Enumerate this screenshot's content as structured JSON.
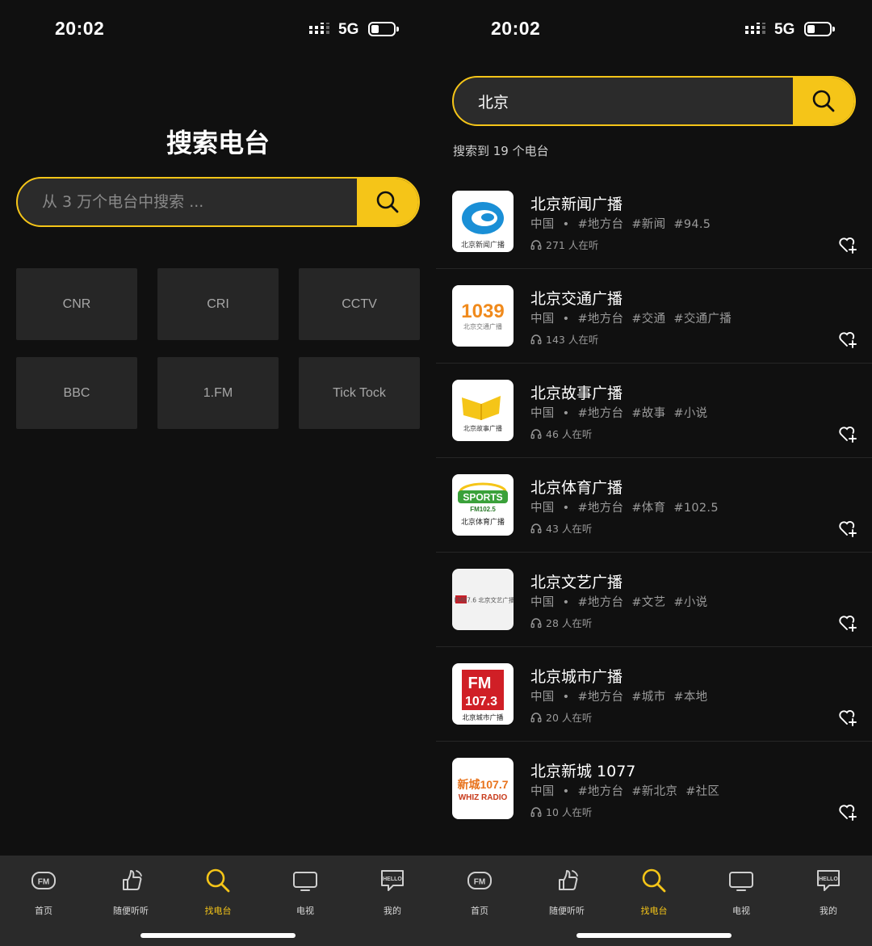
{
  "colors": {
    "accent": "#f5c518",
    "background": "#101010",
    "tile": "#262626",
    "tabbar": "#2a2a2a",
    "muted": "#9a9a9a"
  },
  "status_bar": {
    "time": "20:02",
    "network": "5G"
  },
  "left": {
    "title": "搜索电台",
    "search": {
      "placeholder": "从 3 万个电台中搜索 ...",
      "value": ""
    },
    "categories": [
      "CNR",
      "CRI",
      "CCTV",
      "BBC",
      "1.FM",
      "Tick Tock"
    ]
  },
  "right": {
    "search": {
      "placeholder": "",
      "value": "北京"
    },
    "result_count": "搜索到 19 个电台",
    "stations": [
      {
        "name": "北京新闻广播",
        "country": "中国",
        "dot": "•",
        "tags": [
          "#地方台",
          "#新闻",
          "#94.5"
        ],
        "listeners": "271 人在听",
        "logo": "beijing-news-logo"
      },
      {
        "name": "北京交通广播",
        "country": "中国",
        "dot": "•",
        "tags": [
          "#地方台",
          "#交通",
          "#交通广播"
        ],
        "listeners": "143 人在听",
        "logo": "1039-logo",
        "logo_text": "1039",
        "logo_sub": "北京交通广播"
      },
      {
        "name": "北京故事广播",
        "country": "中国",
        "dot": "•",
        "tags": [
          "#地方台",
          "#故事",
          "#小说"
        ],
        "listeners": "46 人在听",
        "logo": "story-book-logo",
        "logo_sub": "北京故事广播"
      },
      {
        "name": "北京体育广播",
        "country": "中国",
        "dot": "•",
        "tags": [
          "#地方台",
          "#体育",
          "#102.5"
        ],
        "listeners": "43 人在听",
        "logo": "sports-logo",
        "logo_text": "SPORTS",
        "logo_freq": "FM102.5",
        "logo_sub": "北京体育广播"
      },
      {
        "name": "北京文艺广播",
        "country": "中国",
        "dot": "•",
        "tags": [
          "#地方台",
          "#文艺",
          "#小说"
        ],
        "listeners": "28 人在听",
        "logo": "arts-logo",
        "logo_text": "FM87.6 北京文艺广播"
      },
      {
        "name": "北京城市广播",
        "country": "中国",
        "dot": "•",
        "tags": [
          "#地方台",
          "#城市",
          "#本地"
        ],
        "listeners": "20 人在听",
        "logo": "fm1073-logo",
        "logo_text": "FM",
        "logo_freq": "107.3",
        "logo_sub": "北京城市广播"
      },
      {
        "name": "北京新城 1077",
        "country": "中国",
        "dot": "•",
        "tags": [
          "#地方台",
          "#新北京",
          "#社区"
        ],
        "listeners": "10 人在听",
        "logo": "whiz-radio-logo",
        "logo_text": "新城107.7",
        "logo_sub": "WHIZ RADIO"
      }
    ]
  },
  "tabs": [
    {
      "label": "首页",
      "icon": "fm-icon",
      "active": false
    },
    {
      "label": "随便听听",
      "icon": "hand-icon",
      "active": false
    },
    {
      "label": "找电台",
      "icon": "search-icon",
      "active": true
    },
    {
      "label": "电视",
      "icon": "tv-icon",
      "active": false
    },
    {
      "label": "我的",
      "icon": "hello-badge-icon",
      "active": false
    }
  ]
}
